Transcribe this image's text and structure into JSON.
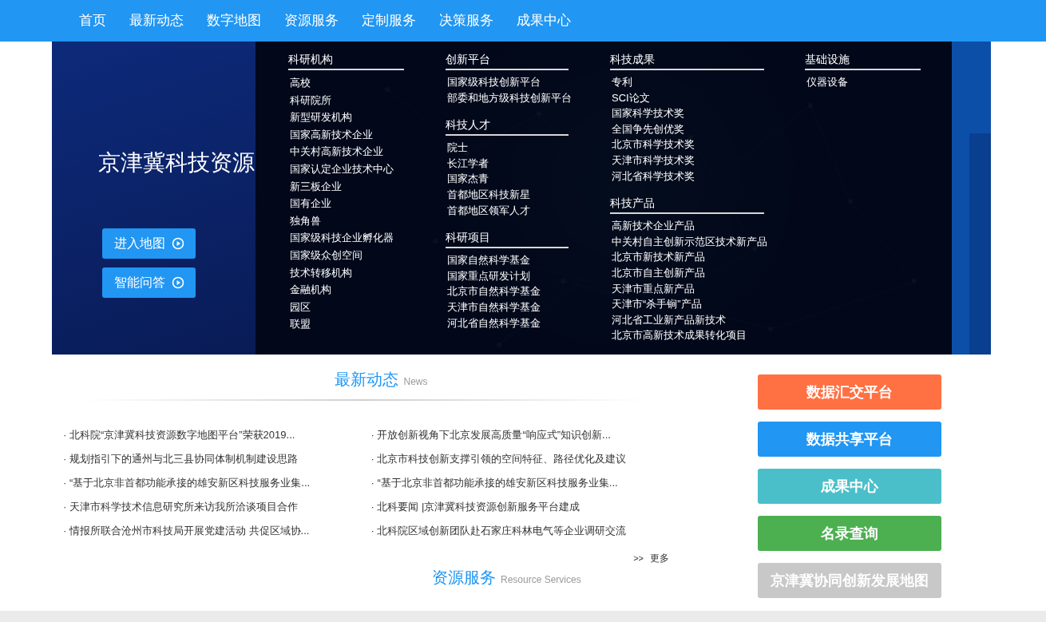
{
  "nav": [
    "首页",
    "最新动态",
    "数字地图",
    "资源服务",
    "定制服务",
    "决策服务",
    "成果中心"
  ],
  "banner": {
    "title": "京津冀科技资源",
    "buttons": [
      "进入地图",
      "智能问答"
    ]
  },
  "menu": {
    "columns": [
      {
        "groups": [
          {
            "heading": "科研机构",
            "items": [
              "高校",
              "科研院所",
              "新型研发机构",
              "国家高新技术企业",
              "中关村高新技术企业",
              "国家认定企业技术中心",
              "新三板企业",
              "国有企业",
              "独角兽",
              "国家级科技企业孵化器",
              "国家级众创空间",
              "技术转移机构",
              "金融机构",
              "园区",
              "联盟"
            ]
          }
        ]
      },
      {
        "groups": [
          {
            "heading": "创新平台",
            "items": [
              "国家级科技创新平台",
              "部委和地方级科技创新平台"
            ]
          },
          {
            "heading": "科技人才",
            "items": [
              "院士",
              "长江学者",
              "国家杰青",
              "首都地区科技新星",
              "首都地区领军人才"
            ]
          },
          {
            "heading": "科研项目",
            "items": [
              "国家自然科学基金",
              "国家重点研发计划",
              "北京市自然科学基金",
              "天津市自然科学基金",
              "河北省自然科学基金"
            ]
          }
        ]
      },
      {
        "groups": [
          {
            "heading": "科技成果",
            "items": [
              "专利",
              "SCI论文",
              "国家科学技术奖",
              "全国争先创优奖",
              "北京市科学技术奖",
              "天津市科学技术奖",
              "河北省科学技术奖"
            ]
          },
          {
            "heading": "科技产品",
            "items": [
              "高新技术企业产品",
              "中关村自主创新示范区技术新产品",
              "北京市新技术新产品",
              "北京市自主创新产品",
              "天津市重点新产品",
              "天津市“杀手锏”产品",
              "河北省工业新产品新技术",
              "北京市高新技术成果转化项目"
            ]
          }
        ]
      },
      {
        "groups": [
          {
            "heading": "基础设施",
            "items": [
              "仪器设备"
            ]
          }
        ]
      }
    ]
  },
  "news": {
    "title": "最新动态",
    "subtitle": "News",
    "columns": [
      [
        "· 北科院“京津冀科技资源数字地图平台”荣获2019...",
        "· 规划指引下的通州与北三县协同体制机制建设思路",
        "· “基于北京非首都功能承接的雄安新区科技服务业集...",
        "· 天津市科学技术信息研究所来访我所洽谈项目合作",
        "· 情报所联合沧州市科技局开展党建活动 共促区域协..."
      ],
      [
        "· 开放创新视角下北京发展高质量“响应式”知识创新...",
        "· 北京市科技创新支撑引领的空间特征、路径优化及建议",
        "· “基于北京非首都功能承接的雄安新区科技服务业集...",
        "· 北科要闻 |京津冀科技资源创新服务平台建成",
        "· 北科院区域创新团队赴石家庄科林电气等企业调研交流"
      ]
    ],
    "more": {
      "arrow": ">>",
      "label": "更多"
    }
  },
  "resources": {
    "title": "资源服务",
    "subtitle": "Resource Services"
  },
  "platforms": [
    {
      "label": "数据汇交平台",
      "color": "#ff7043"
    },
    {
      "label": "数据共享平台",
      "color": "#2196f3"
    },
    {
      "label": "成果中心",
      "color": "#4bbfc9"
    },
    {
      "label": "名录查询",
      "color": "#4caf50"
    },
    {
      "label": "京津冀协同创新发展地图",
      "color": "#c8c8c8"
    }
  ]
}
